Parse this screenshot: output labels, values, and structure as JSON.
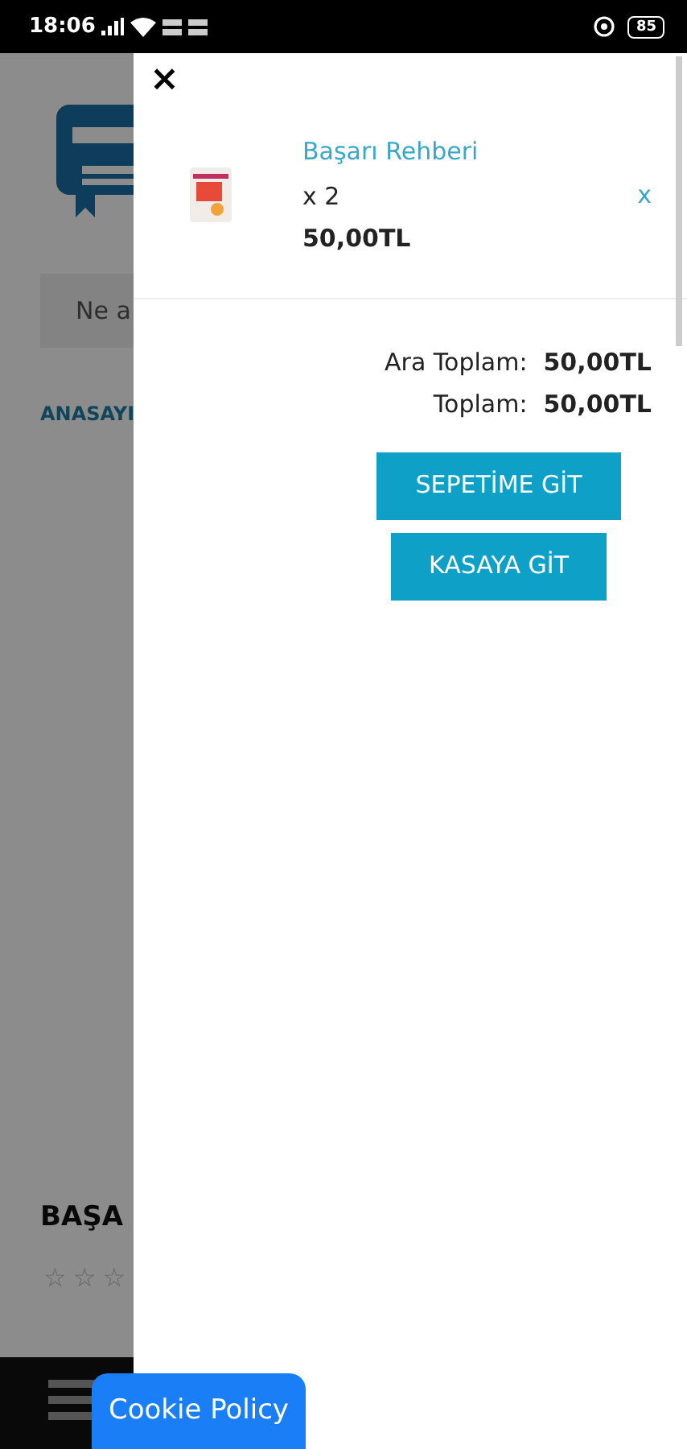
{
  "status_bar": {
    "time": "18:06",
    "battery": "85"
  },
  "background_page": {
    "search_placeholder": "Ne a",
    "nav_link": "ANASAYI",
    "product_title": "BAŞA",
    "stars": 0
  },
  "cart_drawer": {
    "close": "×",
    "items": [
      {
        "name": "Başarı Rehberi",
        "quantity": "x 2",
        "price": "50,00TL",
        "remove": "x"
      }
    ],
    "totals": [
      {
        "label": "Ara Toplam:",
        "value": "50,00TL"
      },
      {
        "label": "Toplam:",
        "value": "50,00TL"
      }
    ],
    "buttons": [
      "SEPETİME GİT",
      "KASAYA GİT"
    ]
  },
  "cookie_button": "Cookie Policy"
}
